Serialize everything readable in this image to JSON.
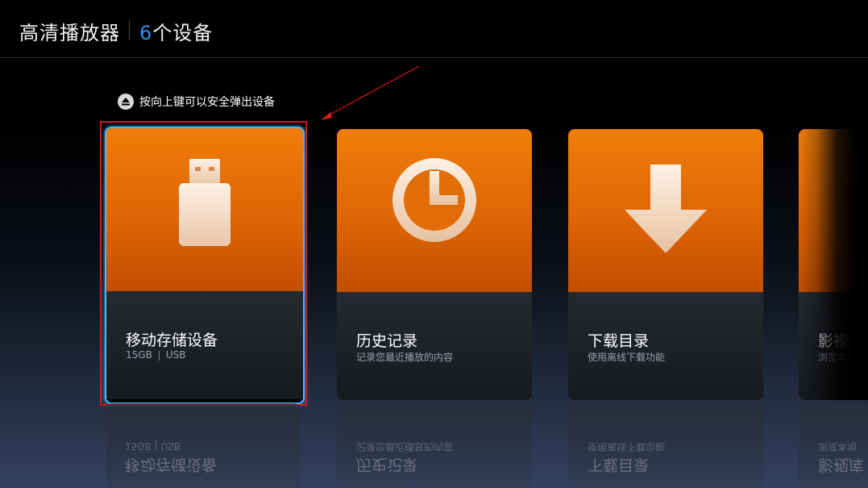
{
  "header": {
    "app_title": "高清播放器",
    "device_count_number": "6",
    "device_count_label": "个设备"
  },
  "eject_hint": {
    "icon": "eject-icon",
    "text": "按向上键可以安全弹出设备"
  },
  "cards": [
    {
      "label": "移动存储设备",
      "sub_size": "15GB",
      "sub_type": "USB",
      "icon": "usb-drive-icon",
      "selected": true
    },
    {
      "label": "历史记录",
      "sub": "记录您最近播放的内容",
      "icon": "clock-icon"
    },
    {
      "label": "下载目录",
      "sub": "使用离线下载功能",
      "icon": "download-arrow-icon"
    },
    {
      "label": "影视库",
      "sub": "浏览本地",
      "icon": "video-library-icon"
    }
  ],
  "colors": {
    "accent_blue": "#2f8ff0",
    "card_orange": "#e86f06",
    "selection_border": "#52b4f2",
    "annotation_red": "#d8161c"
  }
}
